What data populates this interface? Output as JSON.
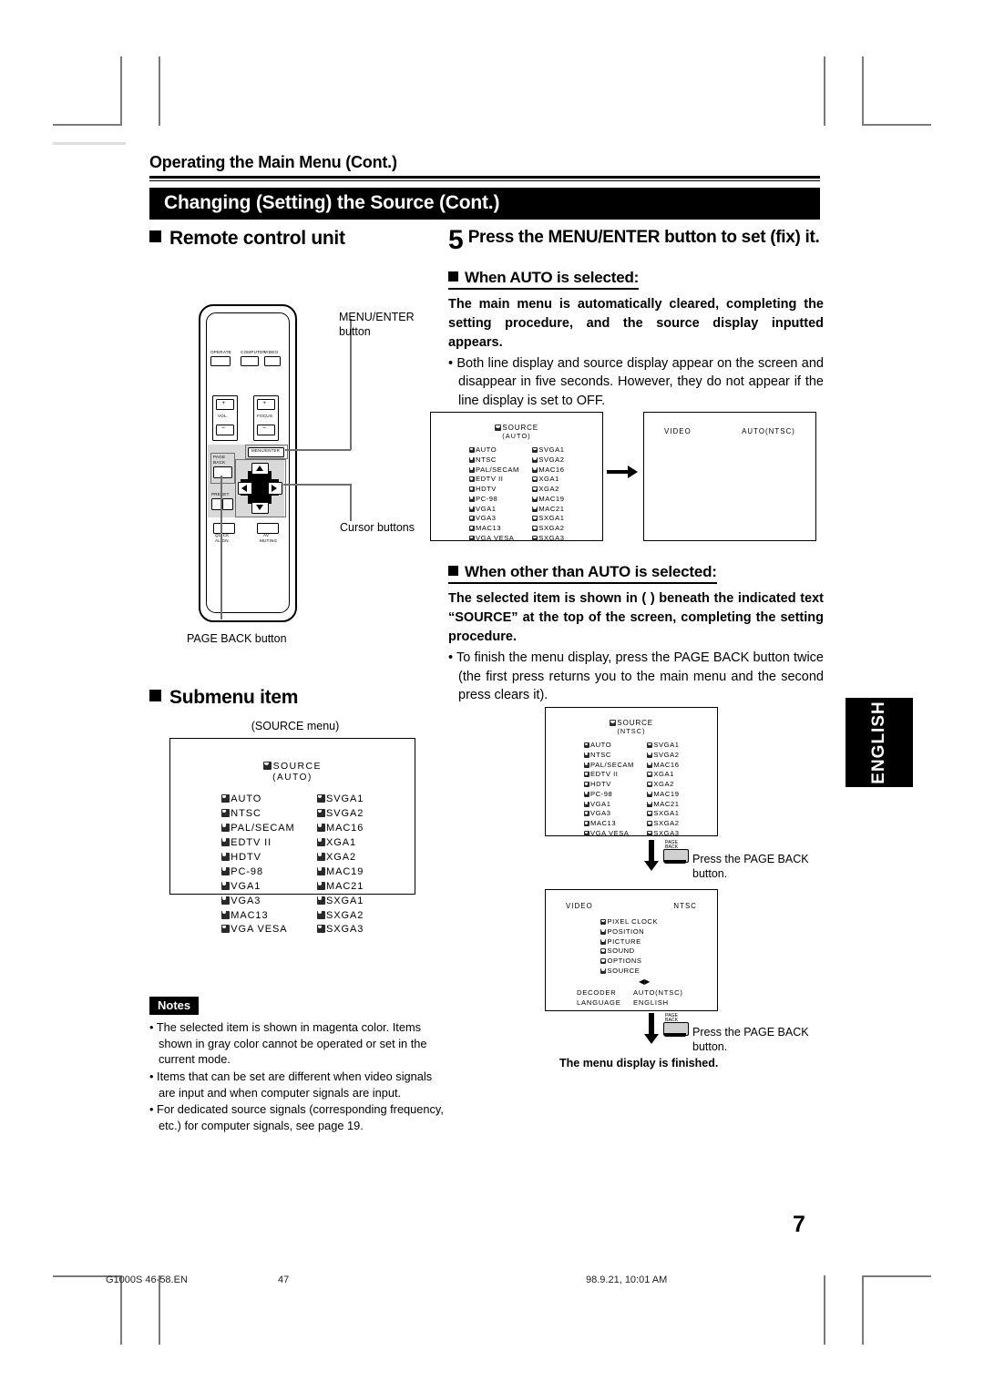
{
  "header": {
    "running_head": "Operating the Main Menu (Cont.)",
    "section_title": "Changing (Setting) the Source (Cont.)"
  },
  "left": {
    "remote_heading": "Remote control unit",
    "submenu_heading": "Submenu item",
    "callouts": {
      "menu_enter": "MENU/ENTER\nbutton",
      "menu_enter_line1": "MENU/ENTER",
      "menu_enter_line2": "button",
      "cursor_buttons": "Cursor buttons",
      "page_back_button": "PAGE BACK button"
    },
    "remote_labels": {
      "operate": "OPERATE",
      "computer": "COMPUTER",
      "video": "VIDEO",
      "vol": "VOL.",
      "focus": "FOCUS",
      "plus": "+",
      "minus": "–",
      "menu_enter": "MENU/ENTER",
      "page_back_l1": "PAGE",
      "page_back_l2": "BACK",
      "preset": "PRESET",
      "quick_align_l1": "QUICK",
      "quick_align_l2": "ALIGN.",
      "av_muting_l1": "AV",
      "av_muting_l2": "MUTING"
    },
    "source_menu_caption": "(SOURCE menu)"
  },
  "right": {
    "step5": {
      "number": "5",
      "text": "Press the MENU/ENTER button to set (fix) it."
    },
    "auto_section": {
      "heading": "When AUTO is selected:",
      "bold": "The main menu is automatically cleared, completing the setting procedure, and the source display inputted appears.",
      "bullets": [
        "Both line display and source display appear on the screen and disappear in five seconds. However, they do not appear if the line display is set to OFF."
      ]
    },
    "other_section": {
      "heading": "When other than AUTO is selected:",
      "bold": "The selected item is shown in (   ) beneath the indicated text “SOURCE” at the top of the screen, completing the setting procedure.",
      "bullets": [
        "To finish the menu display, press the PAGE BACK button twice (the first press returns you to the main menu and the second press clears it)."
      ]
    },
    "press_page_back_1_l1": "Press the PAGE BACK",
    "press_page_back_1_l2": "button.",
    "press_page_back_2_l1": "Press the PAGE BACK",
    "press_page_back_2_l2": "button.",
    "menu_finished": "The menu display is finished."
  },
  "osd": {
    "title": "SOURCE",
    "auto_sub": "(AUTO)",
    "ntsc_sub": "(NTSC)",
    "col_left": [
      "AUTO",
      "NTSC",
      "PAL/SECAM",
      "EDTV II",
      "HDTV",
      "PC-98",
      "VGA1",
      "VGA3",
      "MAC13",
      "VGA VESA"
    ],
    "col_right": [
      "SVGA1",
      "SVGA2",
      "MAC16",
      "XGA1",
      "XGA2",
      "MAC19",
      "MAC21",
      "SXGA1",
      "SXGA2",
      "SXGA3"
    ],
    "line_display": {
      "left": "VIDEO",
      "right": "AUTO(NTSC)"
    },
    "main_menu": {
      "header_left": "VIDEO",
      "header_right": "NTSC",
      "items": [
        "PIXEL CLOCK",
        "POSITION",
        "PICTURE",
        "SOUND",
        "OPTIONS",
        "SOURCE"
      ],
      "footer": [
        {
          "label": "DECODER",
          "value": "AUTO(NTSC)"
        },
        {
          "label": "LANGUAGE",
          "value": "ENGLISH"
        }
      ]
    }
  },
  "notes": {
    "badge": "Notes",
    "items": [
      "The selected item is shown in magenta color. Items shown in gray color cannot be operated or set in the current mode.",
      "Items that can be set are different when video signals are input and when computer signals are input.",
      "For dedicated source signals (corresponding frequency, etc.) for computer signals, see page 19."
    ]
  },
  "sidebar": {
    "language_tab": "ENGLISH"
  },
  "footer": {
    "page_number": "7",
    "file_name": "G1000S 46-58.EN",
    "sheet_number": "47",
    "timestamp": "98.9.21, 10:01 AM"
  }
}
